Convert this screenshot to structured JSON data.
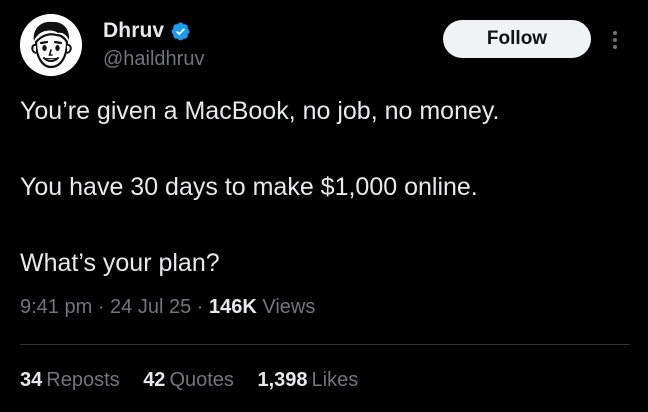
{
  "author": {
    "display_name": "Dhruv",
    "handle": "@haildhruv",
    "verified_icon": "verified-badge-icon",
    "avatar_icon": "cartoon-face-avatar"
  },
  "follow_label": "Follow",
  "more_icon": "more-vertical-icon",
  "body": {
    "line1": "You’re given a MacBook, no job, no money.",
    "line2": "You have 30 days to make $1,000 online.",
    "line3": "What’s your plan?"
  },
  "meta": {
    "time": "9:41 pm",
    "sep1": " · ",
    "date": "24 Jul 25",
    "sep2": " · ",
    "views_count": "146K",
    "views_label": " Views"
  },
  "stats": {
    "reposts_count": "34",
    "reposts_label": "Reposts",
    "quotes_count": "42",
    "quotes_label": "Quotes",
    "likes_count": "1,398",
    "likes_label": "Likes"
  },
  "colors": {
    "background": "#000000",
    "text": "#e7e9ea",
    "muted": "#71767b",
    "verified": "#1d9bf0",
    "follow_bg": "#eff3f4"
  }
}
